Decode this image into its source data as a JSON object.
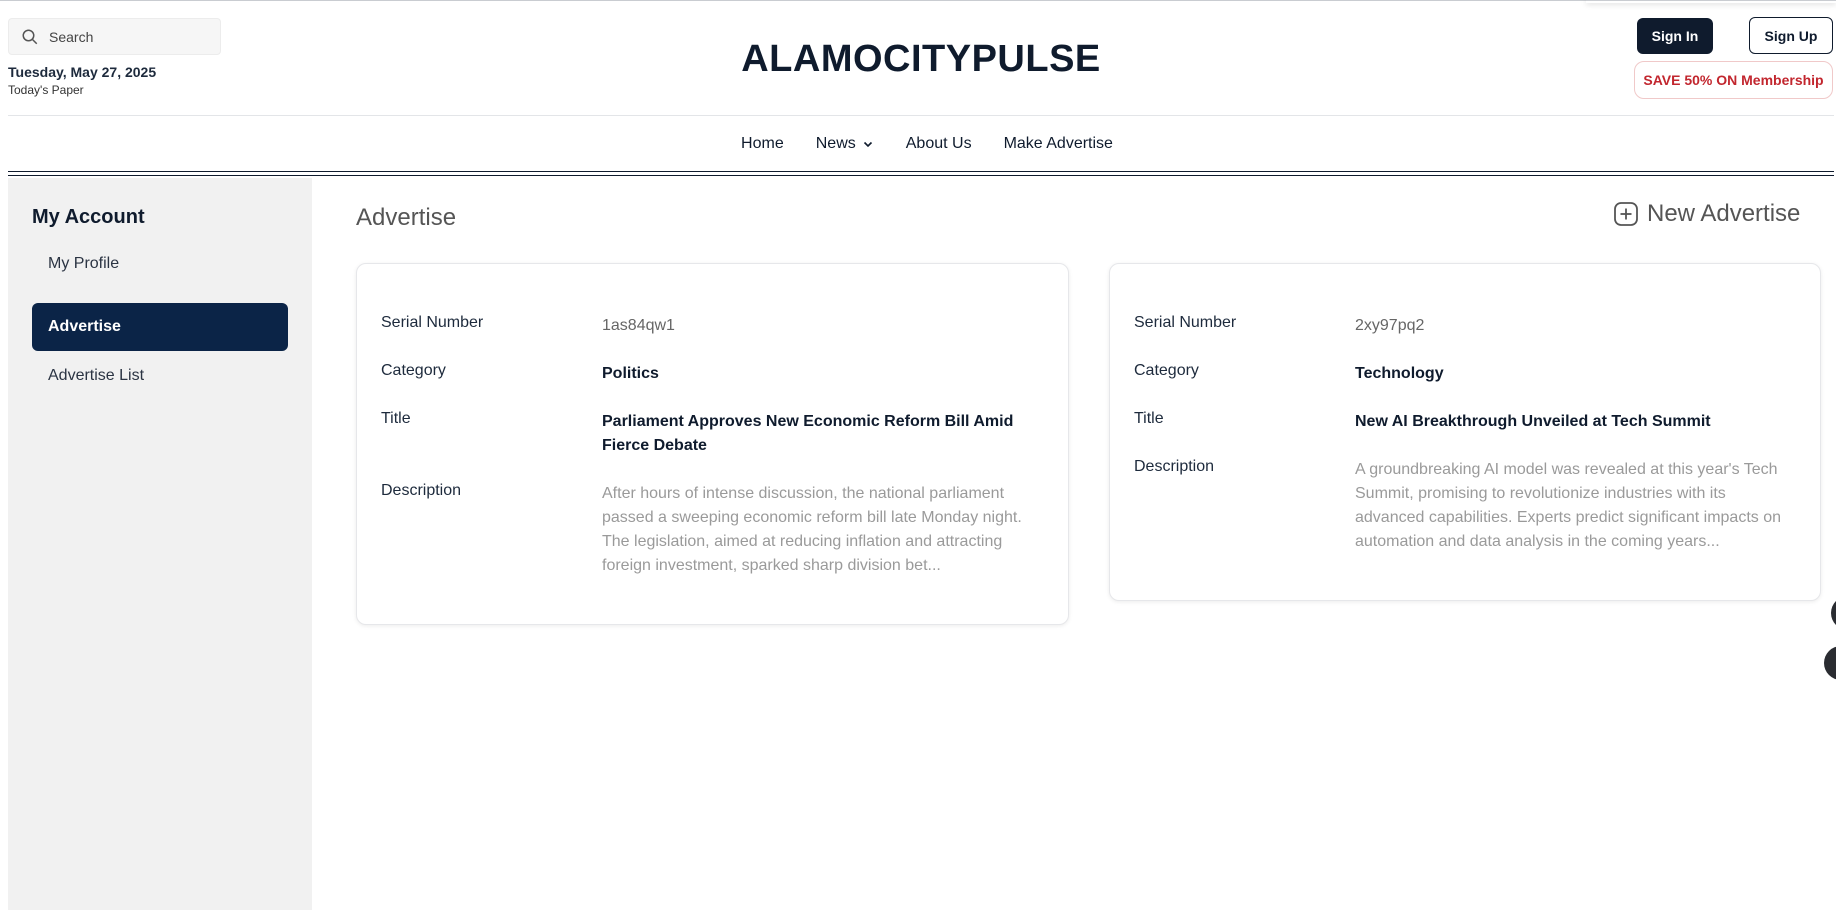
{
  "header": {
    "search_placeholder": "Search",
    "date": "Tuesday, May 27, 2025",
    "paper": "Today's Paper",
    "brand": "ALAMOCITYPULSE",
    "sign_in": "Sign In",
    "sign_up": "Sign Up",
    "promo": "SAVE 50% ON Membership"
  },
  "nav": {
    "items": [
      "Home",
      "News",
      "About Us",
      "Make Advertise"
    ]
  },
  "sidebar": {
    "title": "My Account",
    "items": [
      {
        "label": "My Profile",
        "active": false
      },
      {
        "label": "Advertise",
        "active": true
      },
      {
        "label": "Advertise List",
        "active": false
      }
    ]
  },
  "main": {
    "title": "Advertise",
    "new_button": "New Advertise",
    "labels": {
      "serial": "Serial Number",
      "category": "Category",
      "title": "Title",
      "description": "Description"
    },
    "cards": [
      {
        "serial": "1as84qw1",
        "category": "Politics",
        "title": "Parliament Approves New Economic Reform Bill Amid Fierce Debate",
        "description": "After hours of intense discussion, the national parliament passed a sweeping economic reform bill late Monday night. The legislation, aimed at reducing inflation and attracting foreign investment, sparked sharp division bet..."
      },
      {
        "serial": "2xy97pq2",
        "category": "Technology",
        "title": "New AI Breakthrough Unveiled at Tech Summit",
        "description": "A groundbreaking AI model was revealed at this year's Tech Summit, promising to revolutionize industries with its advanced capabilities. Experts predict significant impacts on automation and data analysis in the coming years..."
      }
    ]
  },
  "colors": {
    "navy": "#0f1b2d",
    "active": "#0b2447",
    "promo_red": "#c2262e",
    "sidebar_bg": "#f1f1f1"
  },
  "icons": {
    "search": "search-icon",
    "chevron": "chevron-down-icon",
    "add": "plus-square-icon"
  }
}
